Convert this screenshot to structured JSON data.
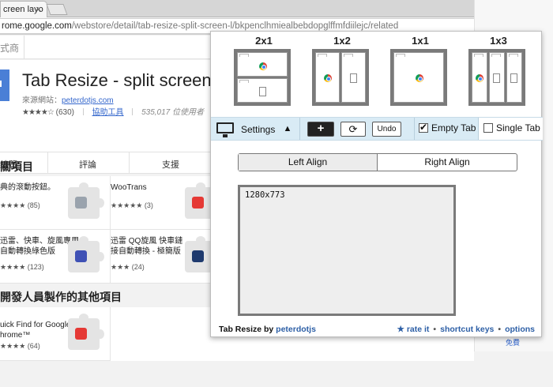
{
  "browser": {
    "tab_title": "creen layo",
    "tab_close": "×",
    "window_control": "⊠",
    "url_host": "rome.google.com",
    "url_path": "/webstore/detail/tab-resize-split-screen-l/bkpenclhmiealbebdopglffmfdiilejc/related",
    "star_glyph": "☆",
    "menu_glyph": "⋮"
  },
  "store": {
    "header_link": "式商",
    "title": "Tab Resize - split screen layo",
    "developer_prefix": "來源網站：",
    "developer_link": "peterdotjs.com",
    "stars": "★★★★☆",
    "rating_count": "(630)",
    "category": "協助工具",
    "users": "535,017 位使用者",
    "tabs": [
      "總覽",
      "評論",
      "支援"
    ],
    "related_title": "關項目",
    "more_title": "開發人員製作的其他項目",
    "cards": [
      {
        "name": "典的滾動按鈕。",
        "stars": "★★★★",
        "count": "(85)",
        "badge_color": "#9aa3ad"
      },
      {
        "name": "WooTrans",
        "stars": "★★★★★",
        "count": "(3)",
        "badge_color": "#e53935"
      },
      {
        "name": "迅雷、快車、旋風專用\n自動轉換綠色版",
        "stars": "★★★★",
        "count": "(123)",
        "badge_color": "#3f51b5"
      },
      {
        "name": "迅雷 QQ旋風 快車鏈\n接自動轉換 - 極簡版",
        "stars": "★★★",
        "count": "(24)",
        "badge_color": "#1e3a6e"
      }
    ],
    "more_card": {
      "name": "uick Find for Google\nhrome™",
      "stars": "★★★★",
      "count": "(64)",
      "badge_color": "#e53935"
    },
    "free_label": "免費"
  },
  "popup": {
    "layouts": [
      {
        "label": "2x1"
      },
      {
        "label": "1x2"
      },
      {
        "label": "1x1"
      },
      {
        "label": "1x3"
      }
    ],
    "settings_label": "Settings",
    "collapse_glyph": "▲",
    "plus_glyph": "+",
    "refresh_glyph": "⟳",
    "undo_label": "Undo",
    "empty_tab_label": "Empty Tab",
    "empty_tab_checked": true,
    "single_tab_label": "Single Tab",
    "single_tab_checked": false,
    "align_left_label": "Left Align",
    "align_right_label": "Right Align",
    "resolution": "1280x773",
    "footer_prefix": "Tab Resize by ",
    "footer_author": "peterdotjs",
    "rate_label": "★ rate it",
    "shortcut_label": "shortcut keys",
    "options_label": "options",
    "footer_dot": "•"
  },
  "colors": {
    "accent_blue": "#2d5fa6",
    "control_bar": "#d9ebf5",
    "thumb_gray": "#7a7a7a"
  }
}
